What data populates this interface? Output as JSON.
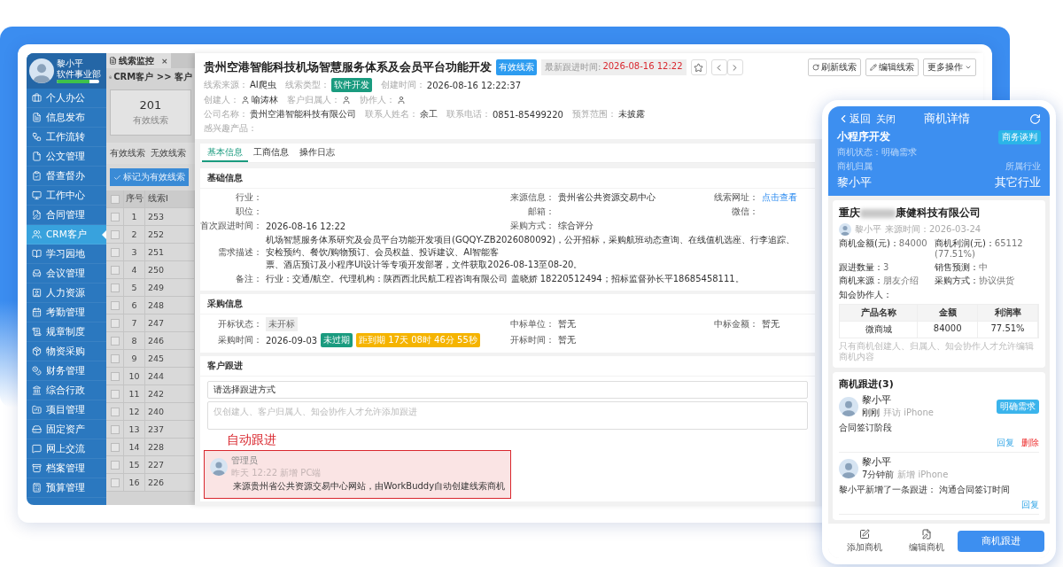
{
  "sidebar": {
    "user": {
      "name": "黎小平",
      "department": "软件事业部",
      "level": 0.78
    },
    "items": [
      {
        "label": "个人办公",
        "selected": false
      },
      {
        "label": "信息发布",
        "selected": false
      },
      {
        "label": "工作流转",
        "selected": false
      },
      {
        "label": "公文管理",
        "selected": false
      },
      {
        "label": "督查督办",
        "selected": false
      },
      {
        "label": "工作中心",
        "selected": false
      },
      {
        "label": "合同管理",
        "selected": false
      },
      {
        "label": "CRM客户",
        "selected": true
      },
      {
        "label": "学习园地",
        "selected": false
      },
      {
        "label": "会议管理",
        "selected": false
      },
      {
        "label": "人力资源",
        "selected": false
      },
      {
        "label": "考勤管理",
        "selected": false
      },
      {
        "label": "规章制度",
        "selected": false
      },
      {
        "label": "物资采购",
        "selected": false
      },
      {
        "label": "财务管理",
        "selected": false
      },
      {
        "label": "综合行政",
        "selected": false
      },
      {
        "label": "项目管理",
        "selected": false
      },
      {
        "label": "固定资产",
        "selected": false
      },
      {
        "label": "网上交流",
        "selected": false
      },
      {
        "label": "档案管理",
        "selected": false
      },
      {
        "label": "预算管理",
        "selected": false
      }
    ]
  },
  "list_panel": {
    "tab": {
      "label": "线索监控",
      "close": "×"
    },
    "breadcrumb": "CRM客户 >> 客户",
    "stat": {
      "value": "201",
      "label": "有效线索"
    },
    "filters": [
      {
        "label": "有效线索",
        "selected": false
      },
      {
        "label": "无效线索",
        "selected": false
      }
    ],
    "mark_button": "标记为有效线索",
    "header_checked": false,
    "columns": [
      "序号",
      "线索I"
    ],
    "rows": [
      {
        "no": "1",
        "id": "253",
        "checked": false
      },
      {
        "no": "2",
        "id": "252",
        "checked": false
      },
      {
        "no": "3",
        "id": "251",
        "checked": false
      },
      {
        "no": "4",
        "id": "250",
        "checked": false
      },
      {
        "no": "5",
        "id": "249",
        "checked": false
      },
      {
        "no": "6",
        "id": "248",
        "checked": false
      },
      {
        "no": "7",
        "id": "247",
        "checked": false
      },
      {
        "no": "8",
        "id": "246",
        "checked": false
      },
      {
        "no": "9",
        "id": "245",
        "checked": false
      },
      {
        "no": "10",
        "id": "244",
        "checked": false
      },
      {
        "no": "11",
        "id": "242",
        "checked": false
      },
      {
        "no": "12",
        "id": "240",
        "checked": false
      },
      {
        "no": "13",
        "id": "237",
        "checked": false
      },
      {
        "no": "14",
        "id": "228",
        "checked": false
      },
      {
        "no": "15",
        "id": "227",
        "checked": false
      },
      {
        "no": "16",
        "id": "226",
        "checked": false
      }
    ]
  },
  "detail": {
    "title": "贵州空港智能科技机场智慧服务体系及会员平台功能开发",
    "badge": "有效线索",
    "latest_label": "最新跟进时间:",
    "latest_time": "2026-08-16 12:22",
    "actions": [
      {
        "label": "刷新线索",
        "kind": "refresh"
      },
      {
        "label": "编辑线索",
        "kind": "edit"
      },
      {
        "label": "更多操作",
        "kind": "more"
      }
    ],
    "meta": [
      [
        {
          "label": "线索来源：",
          "value": "AI爬虫",
          "kind": "text"
        },
        {
          "label": "线索类型：",
          "value": "软件开发",
          "kind": "tag"
        },
        {
          "label": "创建时间：",
          "value": "2026-08-16 12:22:37",
          "kind": "text"
        }
      ],
      [
        {
          "label": "创建人：",
          "value": "喻涛林",
          "kind": "person"
        },
        {
          "label": "客户归属人：",
          "kind": "person"
        },
        {
          "label": "协作人：",
          "kind": "person"
        }
      ],
      [
        {
          "label": "公司名称：",
          "value": "贵州空港智能科技有限公司",
          "kind": "text"
        },
        {
          "label": "联系人姓名：",
          "value": "余工",
          "kind": "text"
        },
        {
          "label": "联系电话：",
          "value": "0851-85499220",
          "kind": "text"
        },
        {
          "label": "预算范围：",
          "value": "未披露",
          "kind": "text"
        }
      ],
      [
        {
          "label": "感兴趣产品：",
          "kind": "text"
        }
      ]
    ],
    "tabs": [
      {
        "label": "基本信息",
        "selected": true
      },
      {
        "label": "工商信息",
        "selected": false
      },
      {
        "label": "操作日志",
        "selected": false
      }
    ],
    "basic_info": {
      "title": "基础信息",
      "rows": [
        [
          {
            "label": "行业：",
            "kind": "text"
          },
          {
            "label": "来源信息：",
            "value": "贵州省公共资源交易中心",
            "kind": "text"
          },
          {
            "label": "线索网址：",
            "value": "点击查看",
            "kind": "link"
          }
        ],
        [
          {
            "label": "职位：",
            "kind": "text"
          },
          {
            "label": "邮箱：",
            "kind": "text"
          },
          {
            "label": "微信：",
            "kind": "text"
          }
        ],
        [
          {
            "label": "首次跟进时间：",
            "value": "2026-08-16 12:22",
            "kind": "text"
          },
          {
            "label": "采购方式：",
            "value": "综合评分",
            "kind": "text"
          }
        ]
      ],
      "long_fields": [
        {
          "label": "需求描述：",
          "lines": [
            "机场智慧服务体系研究及会员平台功能开发项目(GQQY-ZB2026080092)，公开招标，采购航班动态查询、在线值机选座、行李追踪、安检预约、餐饮/购物预订、会员权益、投诉建议、AI智能客",
            "票、酒店预订及小程序UI设计等专项开发部署，文件获取2026-08-13至08-20。"
          ]
        },
        {
          "label": "备注：",
          "lines": [
            "行业：交通/航空。代理机构：陕西西北民航工程咨询有限公司 盖晓娇 18220512494；招标监督孙长平18685458111。"
          ]
        }
      ]
    },
    "procurement": {
      "title": "采购信息",
      "rows": [
        [
          {
            "label": "开标状态：",
            "value": "未开标",
            "kind": "status"
          },
          {
            "label": "中标单位：",
            "value": "暂无",
            "kind": "text"
          },
          {
            "label": "中标金额：",
            "value": "暂无",
            "kind": "text"
          }
        ],
        [
          {
            "label": "采购时间：",
            "value": "2026-09-03",
            "kind": "text",
            "tags": [
              {
                "text": "未过期",
                "color": "#1a9b7f"
              },
              {
                "text": "距到期 17天 08时 46分 55秒",
                "color": "#f5b400"
              }
            ]
          },
          {
            "label": "开标时间：",
            "value": "暂无",
            "kind": "text"
          }
        ]
      ]
    },
    "follow": {
      "title": "客户跟进",
      "select_value": "请选择跟进方式",
      "placeholder": "仅创建人、客户归属人、知会协作人才允许添加跟进",
      "annotation": "自动跟进",
      "entry": {
        "author": "管理员",
        "meta": "昨天 12:22 新增 PC端",
        "text": "来源贵州省公共资源交易中心网站，由WorkBuddy自动创建线索商机"
      }
    }
  },
  "phone": {
    "back": "返回",
    "close": "关闭",
    "title": "商机详情",
    "name": "小程序开发",
    "stage": "商务谈判",
    "status": "商机状态：明确需求",
    "owner_label": "商机归属",
    "owner": "黎小平",
    "industry_label": "所属行业",
    "industry": "其它行业",
    "company": {
      "name_start": "重庆",
      "name_end": "康健科技有限公司",
      "owner": "黎小平",
      "source_time": "来源时间：2026-03-24",
      "fields": [
        {
          "label": "商机金额(元)：",
          "value": "84000"
        },
        {
          "label": "商机利润(元)：",
          "value": "65112 (77.51%)"
        },
        {
          "label": "跟进数量：",
          "value": "3"
        },
        {
          "label": "销售预测：",
          "value": "中"
        },
        {
          "label": "商机来源：",
          "value": "朋友介绍"
        },
        {
          "label": "采购方式：",
          "value": "协议供货"
        }
      ],
      "collaborators_label": "知会协作人：",
      "columns": [
        "产品名称",
        "金额",
        "利润率"
      ],
      "rows": [
        [
          "微商城",
          "84000",
          "77.51%"
        ]
      ],
      "note": "只有商机创建人、归属人、知会协作人才允许编辑商机内容"
    },
    "follow_title": "商机跟进(3)",
    "entries": [
      {
        "name": "黎小平",
        "time": "刚刚",
        "meta": "拜访 iPhone",
        "tag": "明确需求",
        "text": "合同签订阶段",
        "actions": [
          {
            "label": "回复",
            "kind": "reply"
          },
          {
            "label": "删除",
            "kind": "delete"
          }
        ]
      },
      {
        "name": "黎小平",
        "time": "7分钟前",
        "meta": "新增 iPhone",
        "text": "黎小平新增了一条跟进： 沟通合同签订时间",
        "actions": [
          {
            "label": "回复",
            "kind": "reply"
          }
        ]
      }
    ],
    "bottom": [
      {
        "label": "添加商机",
        "kind": "add"
      },
      {
        "label": "编辑商机",
        "kind": "edit"
      },
      {
        "label": "商机跟进",
        "kind": "primary"
      }
    ]
  }
}
